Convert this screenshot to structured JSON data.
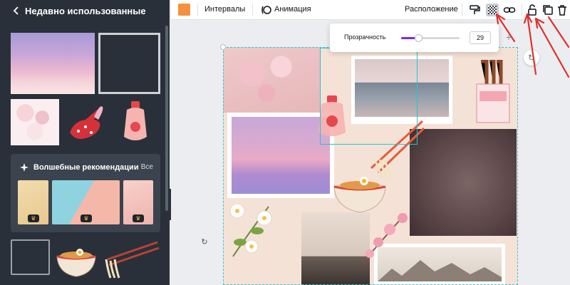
{
  "sidebar": {
    "title": "Недавно использованные",
    "magic": {
      "title": "Волшебные рекомендации",
      "see_all": "Все"
    },
    "collapse_glyph": "‹"
  },
  "toolbar": {
    "color_swatch": "#F4913E",
    "intervals_label": "Интервалы",
    "animation_label": "Анимация",
    "arrange_label": "Расположение"
  },
  "transparency": {
    "label": "Прозрачность",
    "value": "29",
    "level": 0.29
  },
  "canvas": {
    "plus_glyph": "+",
    "rotate_glyph": "↻"
  },
  "colors": {
    "accent": "#7D2AE8",
    "selection": "#23C4D6",
    "sidebar_bg": "#293039",
    "annotation_arrow": "#E0312B"
  }
}
